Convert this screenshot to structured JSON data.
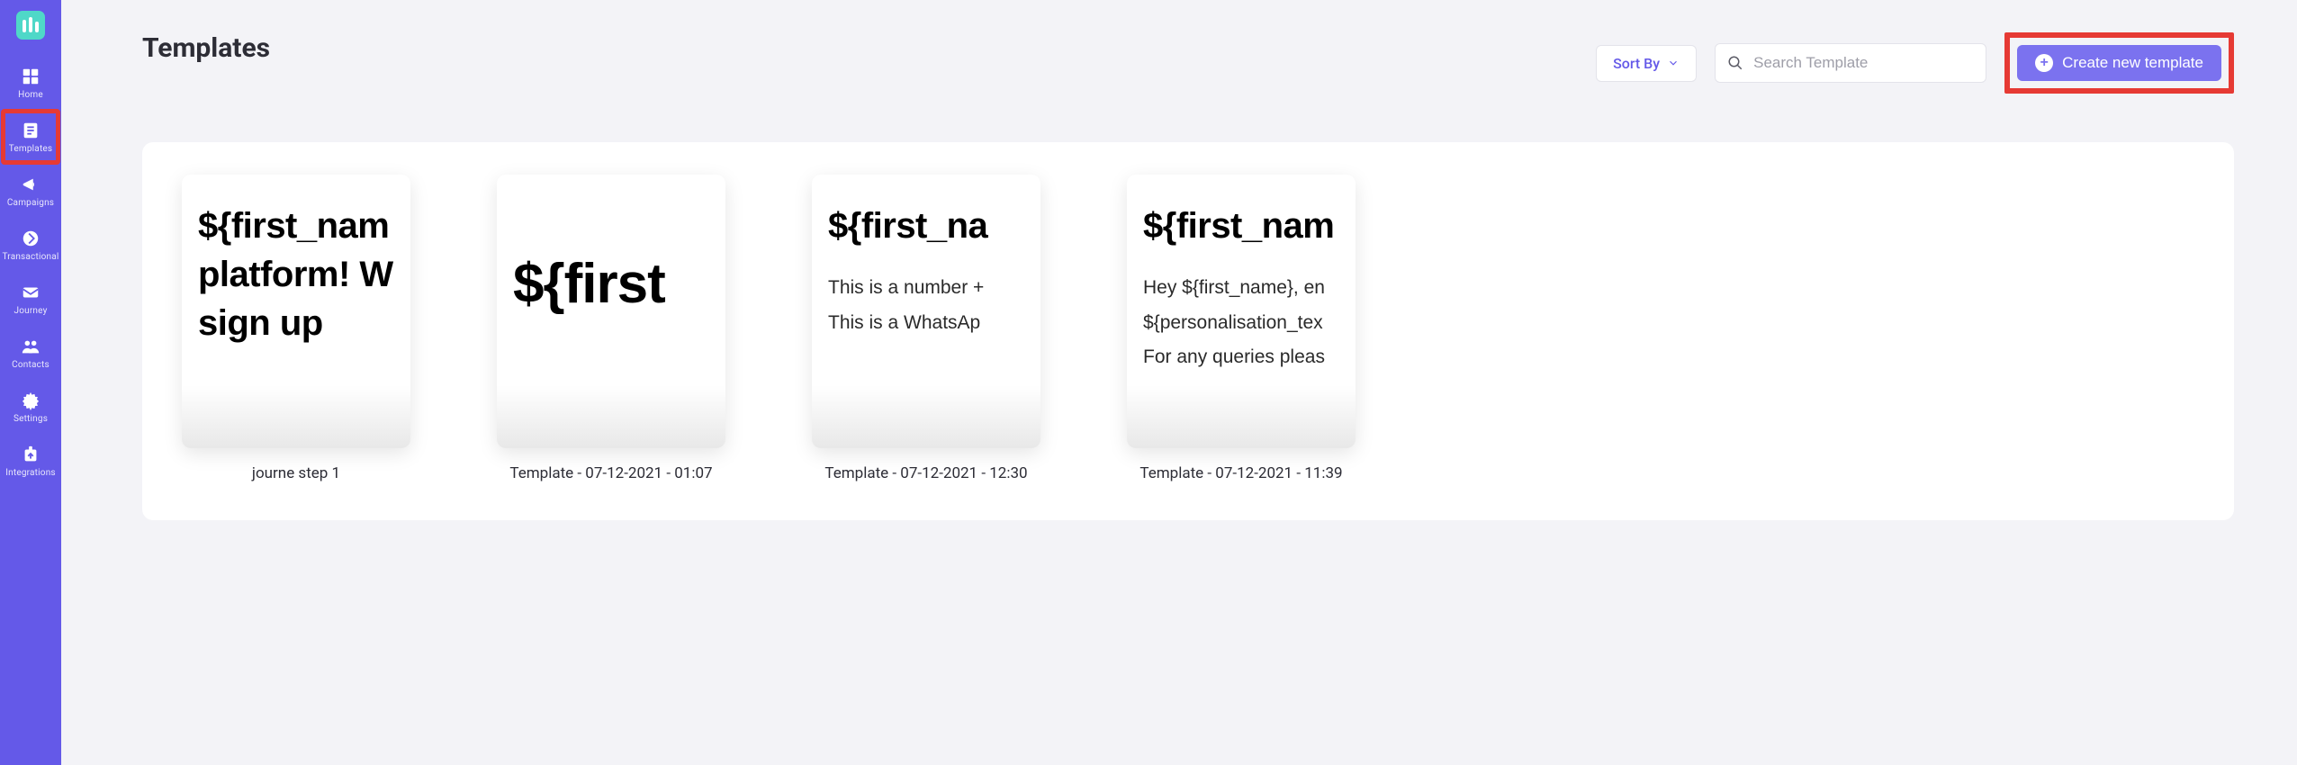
{
  "sidebar": {
    "items": [
      {
        "key": "home",
        "label": "Home"
      },
      {
        "key": "templates",
        "label": "Templates"
      },
      {
        "key": "campaigns",
        "label": "Campaigns"
      },
      {
        "key": "transactional",
        "label": "Transactional"
      },
      {
        "key": "journey",
        "label": "Journey"
      },
      {
        "key": "contacts",
        "label": "Contacts"
      },
      {
        "key": "settings",
        "label": "Settings"
      },
      {
        "key": "integrations",
        "label": "Integrations"
      }
    ]
  },
  "header": {
    "title": "Templates",
    "sort_label": "Sort By",
    "search_placeholder": "Search Template",
    "create_label": "Create new template"
  },
  "templates": [
    {
      "name": "journe step 1",
      "preview_lines": [
        "${first_nam",
        "platform! W",
        "sign up"
      ],
      "sub_lines": []
    },
    {
      "name": "Template - 07-12-2021 - 01:07",
      "preview_lines": [
        "${first"
      ],
      "sub_lines": [],
      "style": "huge"
    },
    {
      "name": "Template - 07-12-2021 - 12:30",
      "preview_lines": [
        "${first_na"
      ],
      "sub_lines": [
        "This is a number +",
        "This is a WhatsAp"
      ]
    },
    {
      "name": "Template - 07-12-2021 - 11:39",
      "preview_lines": [
        "${first_nam"
      ],
      "sub_lines": [
        "Hey ${first_name}, en",
        "${personalisation_tex",
        "For any queries pleas"
      ]
    }
  ]
}
